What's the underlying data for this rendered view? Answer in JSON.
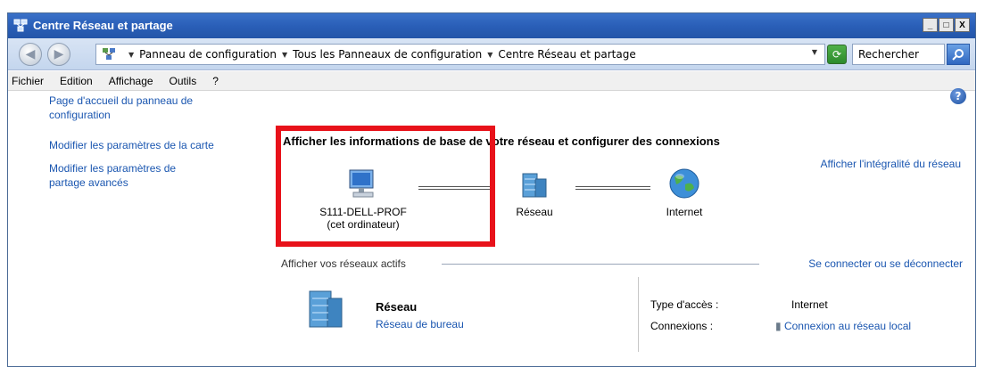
{
  "window": {
    "title": "Centre Réseau et partage",
    "buttons": {
      "minimize": "_",
      "maximize": "□",
      "close": "X"
    }
  },
  "address": {
    "crumbs": [
      "Panneau de configuration",
      "Tous les Panneaux de configuration",
      "Centre Réseau et partage"
    ],
    "search_placeholder": "Rechercher"
  },
  "menu": [
    "Fichier",
    "Edition",
    "Affichage",
    "Outils",
    "?"
  ],
  "sidebar": {
    "links": [
      "Page d'accueil du panneau de configuration",
      "Modifier les paramètres de la carte",
      "Modifier les paramètres de partage avancés"
    ]
  },
  "main": {
    "title": "Afficher les informations de base de votre réseau et configurer des connexions",
    "full_map_link": "Afficher l'intégralité du réseau",
    "nodes": {
      "computer": {
        "name": "S111-DELL-PROF",
        "sub": "(cet ordinateur)"
      },
      "network": {
        "name": "Réseau"
      },
      "internet": {
        "name": "Internet"
      }
    },
    "active_networks": {
      "title": "Afficher vos réseaux actifs",
      "connect_link": "Se connecter ou se déconnecter",
      "network_name": "Réseau",
      "network_type": "Réseau de bureau",
      "access_type_label": "Type d'accès :",
      "access_type_value": "Internet",
      "connections_label": "Connexions :",
      "connections_value": "Connexion au réseau local"
    }
  },
  "colors": {
    "link": "#1a56b0",
    "highlight": "#e8121a",
    "titlebar": "#2a5fb8"
  }
}
